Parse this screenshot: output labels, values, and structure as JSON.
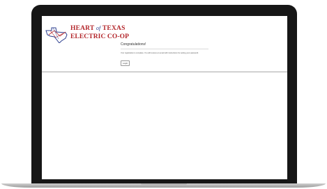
{
  "logo": {
    "line1_heart": "HEART",
    "line1_of": "of",
    "line1_texas": "TEXAS",
    "line2": "ELECTRIC CO-OP"
  },
  "content": {
    "heading": "Congratulations!",
    "message": "Your registration is complete. You will receive an email with instructions for setting your password.",
    "login_button": "Login"
  },
  "colors": {
    "brand_red": "#b3262b",
    "brand_blue": "#2c3f8f",
    "laptop_frame": "#161616"
  }
}
